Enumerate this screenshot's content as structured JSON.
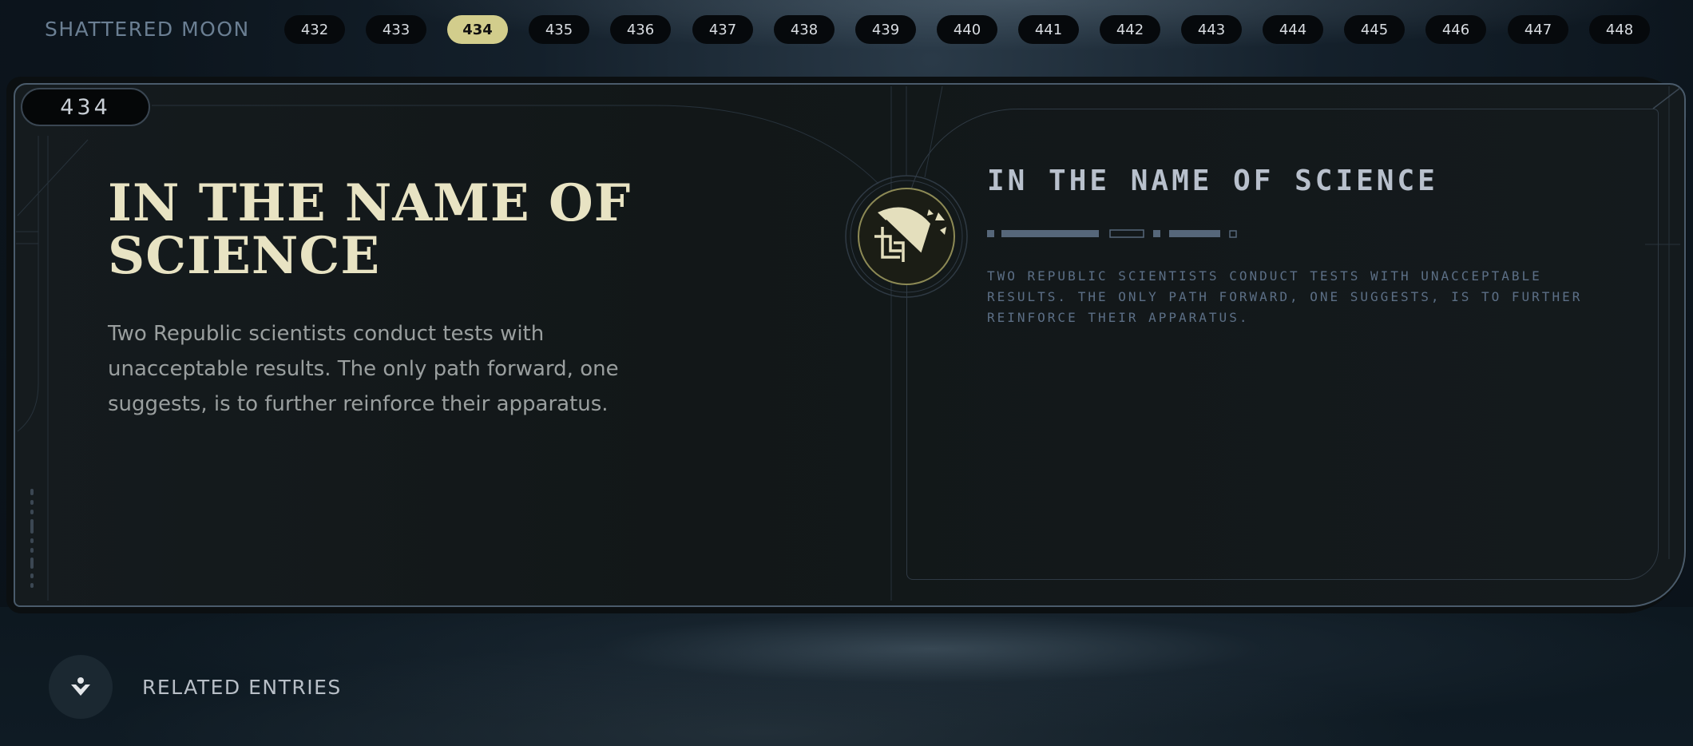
{
  "header": {
    "brand": "SHATTERED MOON",
    "pages": [
      "432",
      "433",
      "434",
      "435",
      "436",
      "437",
      "438",
      "439",
      "440",
      "441",
      "442",
      "443",
      "444",
      "445",
      "446",
      "447",
      "448"
    ],
    "active_page": "434"
  },
  "entry": {
    "number": "434",
    "title": "IN THE NAME OF SCIENCE",
    "description": "Two Republic scientists conduct tests with unacceptable results. The only path forward, one suggests, is to further reinforce their apparatus.",
    "aurebesh_title": "IN THE NAME OF SCIENCE",
    "aurebesh_body": "TWO REPUBLIC SCIENTISTS CONDUCT TESTS WITH UNACCEPTABLE RESULTS. THE ONLY PATH FORWARD, ONE SUGGESTS, IS TO FURTHER REINFORCE THEIR APPARATUS.",
    "emblem": "republic-science-emblem-icon"
  },
  "footer": {
    "related_label": "RELATED ENTRIES",
    "related_icon": "related-entries-icon"
  },
  "colors": {
    "accent": "#d2cd8c",
    "title": "#e8e3c3",
    "frame": "#4a5b6b",
    "aurebesh": "#5c6f86"
  }
}
